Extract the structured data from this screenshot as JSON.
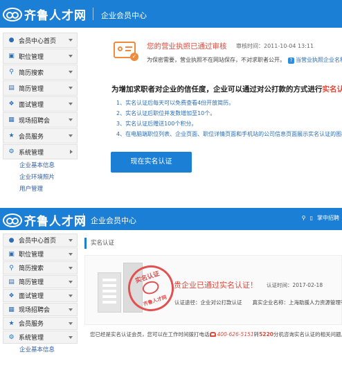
{
  "brand": {
    "logo_text": "齐鲁人才网",
    "section_title": "企业会员中心"
  },
  "top_right": {
    "mobile_label": "掌中招聘"
  },
  "sidebar": {
    "items": [
      {
        "label": "会员中心首页",
        "icon": "user-icon"
      },
      {
        "label": "职位管理",
        "icon": "briefcase-icon"
      },
      {
        "label": "简历搜索",
        "icon": "search-icon"
      },
      {
        "label": "简历管理",
        "icon": "document-icon"
      },
      {
        "label": "面试管理",
        "icon": "handshake-icon"
      },
      {
        "label": "现场招聘会",
        "icon": "bus-icon"
      },
      {
        "label": "会员服务",
        "icon": "service-icon"
      },
      {
        "label": "系统管理",
        "icon": "gear-icon"
      }
    ],
    "sub_items": [
      "企业基本信息",
      "企业环境照片",
      "用户管理"
    ]
  },
  "screen1": {
    "notice": {
      "title": "您的营业执照已通过审核",
      "time": "审核时间：2011-10-04 13:11",
      "desc": "为保密需要，营业执照不在网站保存，不对求职者公开。",
      "link": "当营业执照企业名称"
    },
    "why_title_prefix": "为增加求职者对企业的信任度，企业可以通过对公打款的方式进行",
    "why_title_highlight": "实名认证",
    "why_title_suffix": "。",
    "benefits": [
      "1、实名认证后每天可以免费查看4份开放简历。",
      "2、实名认证后职位并发数增加至10个。",
      "3、实名认证后赠送100个积分。",
      "4、在电脑端职位列表、企业页面、职位详情页面和手机站的公司信息页面展示实名认证的图标"
    ],
    "cta_label": "现在实名认证"
  },
  "screen2": {
    "page_title": "实名认证",
    "stamp_top": "实名认证",
    "stamp_bottom": "齐鲁人才网",
    "verified_title": "贵企业已通过实名认证！",
    "verified_time": "认证时间：2017-02-18",
    "verified_info": "认证途径：企业对公打款认证　　真实企业名称：上海助援人力资源管理有限",
    "footnote_prefix": "您已经是实名认证会员，您可以在工作时间拨打电话",
    "phone": "400-626-5151",
    "footnote_mid": "转",
    "ext": "5220",
    "footnote_suffix": "分机咨询实名认证的相关问题。"
  },
  "colors": {
    "brand_blue": "#1c7fd6",
    "alert_red": "#e0483a",
    "accent_orange": "#f08a3c",
    "link_blue": "#2a6db5"
  }
}
